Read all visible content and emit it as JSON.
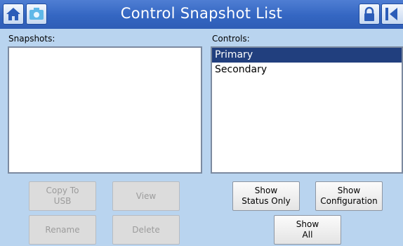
{
  "header": {
    "title": "Control Snapshot List",
    "icons": [
      "home-icon",
      "snapshot-icon",
      "lock-icon",
      "back-icon"
    ]
  },
  "snapshots": {
    "label": "Snapshots:",
    "items": []
  },
  "controls": {
    "label": "Controls:",
    "items": [
      "Primary",
      "Secondary"
    ],
    "selected": "Primary"
  },
  "buttons": {
    "copy_to_usb": "Copy To\nUSB",
    "view": "View",
    "rename": "Rename",
    "delete": "Delete",
    "show_status_only": "Show\nStatus Only",
    "show_configuration": "Show\nConfiguration",
    "show_all": "Show\nAll"
  },
  "colors": {
    "titlebar": "#3466c2",
    "background": "#b9d4ef",
    "selection": "#213f7e"
  }
}
